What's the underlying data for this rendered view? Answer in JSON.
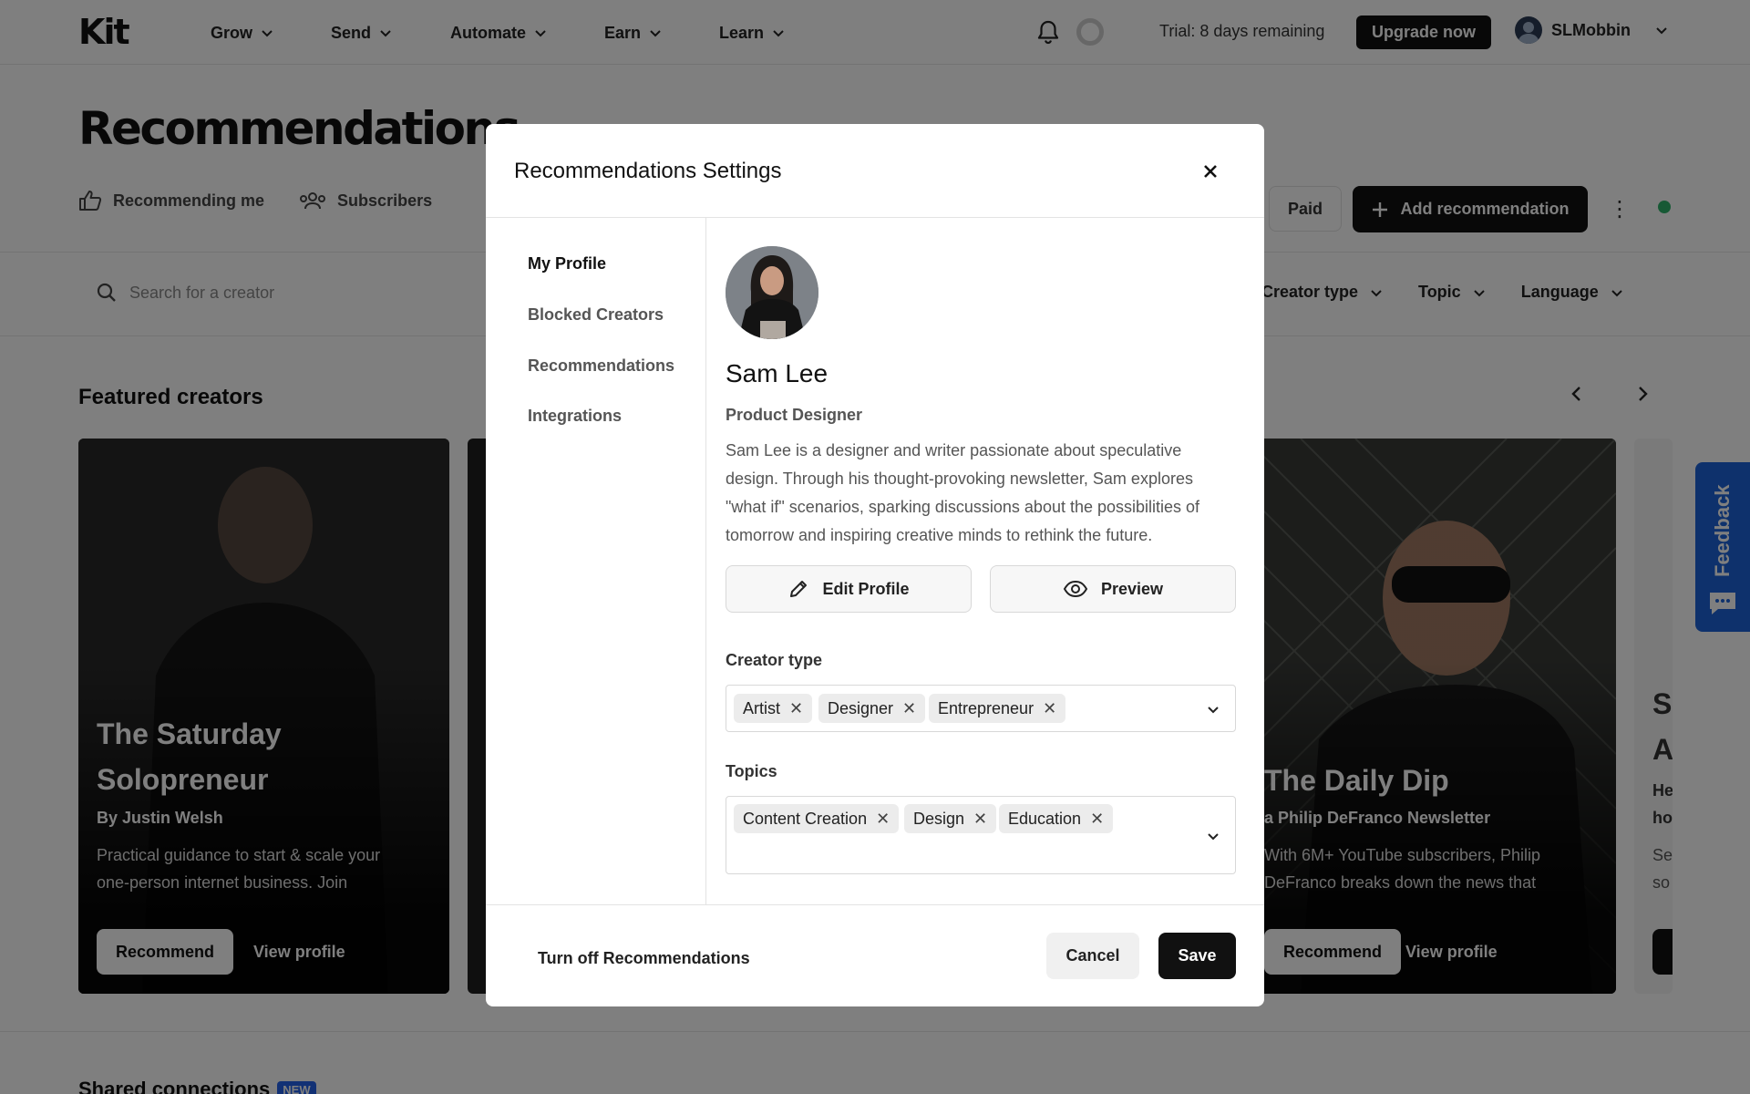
{
  "topnav": {
    "logo": "Kit",
    "menu": [
      "Grow",
      "Send",
      "Automate",
      "Earn",
      "Learn"
    ],
    "trial": "Trial: 8 days remaining",
    "upgrade": "Upgrade now",
    "username": "SLMobbin"
  },
  "page": {
    "title": "Recommendations",
    "subnav": [
      "Recommending me",
      "Subscribers"
    ],
    "paid": "Paid",
    "add_recommendation": "Add recommendation",
    "search_placeholder": "Search for a creator",
    "filters": [
      "Creator type",
      "Topic",
      "Language"
    ],
    "featured": "Featured creators",
    "shared": "Shared connections",
    "new_badge": "NEW",
    "feedback": "Feedback"
  },
  "cards": [
    {
      "title_line1": "The Saturday",
      "title_line2": "Solopreneur",
      "by": "By Justin Welsh",
      "desc_line1": "Practical guidance to start & scale your",
      "desc_line2": "one-person internet business. Join",
      "recommend": "Recommend",
      "view": "View profile"
    },
    {
      "title_line1": "The Daily Dip",
      "by": "a Philip DeFranco Newsletter",
      "desc_line1": "With 6M+ YouTube subscribers, Philip",
      "desc_line2": "DeFranco breaks down the news that",
      "recommend": "Recommend",
      "view": "View profile"
    },
    {
      "title_line1": "S",
      "title_line2": "A",
      "by": "He",
      "by2": "ho",
      "desc_line1": "Se",
      "desc_line2": "so"
    }
  ],
  "modal": {
    "title": "Recommendations Settings",
    "sidebar": [
      "My Profile",
      "Blocked Creators",
      "Recommendations",
      "Integrations"
    ],
    "profile": {
      "name": "Sam Lee",
      "role": "Product Designer",
      "bio": "Sam Lee is a designer and writer passionate about speculative design. Through his thought-provoking newsletter, Sam explores \"what if\" scenarios, sparking discussions about the possibilities of tomorrow and inspiring creative minds to rethink the future."
    },
    "edit_profile": "Edit Profile",
    "preview": "Preview",
    "creator_type_label": "Creator type",
    "creator_types": [
      "Artist",
      "Designer",
      "Entrepreneur"
    ],
    "topics_label": "Topics",
    "topics": [
      "Content Creation",
      "Design",
      "Education"
    ],
    "turn_off": "Turn off Recommendations",
    "cancel": "Cancel",
    "save": "Save"
  }
}
